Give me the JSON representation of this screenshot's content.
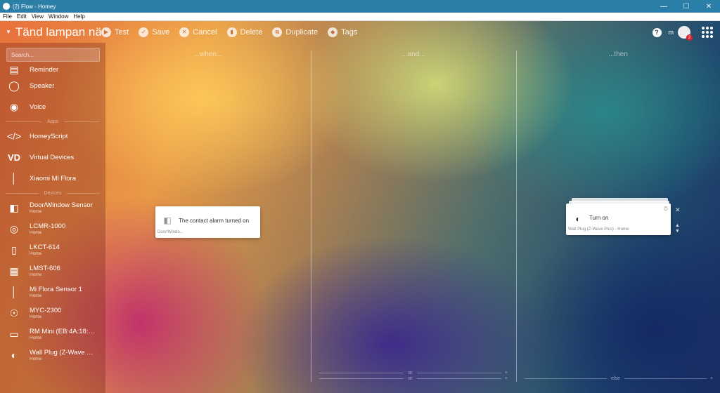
{
  "window": {
    "title": "(2) Flow - Homey"
  },
  "menu": [
    "File",
    "Edit",
    "View",
    "Window",
    "Help"
  ],
  "toolbar": {
    "flow_name": "Tänd lampan nä",
    "test": "Test",
    "save": "Save",
    "cancel": "Cancel",
    "delete": "Delete",
    "duplicate": "Duplicate",
    "tags": "Tags",
    "user_initial": "m",
    "notification_count": "2"
  },
  "sidebar": {
    "search_placeholder": "Search...",
    "partial_label": "Reminder",
    "items_top": [
      {
        "name": "Speaker",
        "icon": "speaker-icon"
      },
      {
        "name": "Voice",
        "icon": "voice-icon"
      }
    ],
    "apps_heading": "Apps",
    "apps": [
      {
        "name": "HomeyScript",
        "icon": "code-icon"
      },
      {
        "name": "Virtual Devices",
        "icon": "vd-icon"
      },
      {
        "name": "Xiaomi Mi Flora",
        "icon": "sensor-icon"
      }
    ],
    "devices_heading": "Devices",
    "devices": [
      {
        "name": "Door/Window Sensor",
        "zone": "Home"
      },
      {
        "name": "LCMR-1000",
        "zone": "Home"
      },
      {
        "name": "LKCT-614",
        "zone": "Home"
      },
      {
        "name": "LMST-606",
        "zone": "Home"
      },
      {
        "name": "Mi Flora Sensor 1",
        "zone": "Home"
      },
      {
        "name": "MYC-2300",
        "zone": "Home"
      },
      {
        "name": "RM Mini (EB:4A:18:7...",
        "zone": "Home"
      },
      {
        "name": "Wall Plug (Z-Wave Pl...",
        "zone": "Home"
      }
    ]
  },
  "columns": {
    "when": "...when...",
    "and": "...and...",
    "then": "...then"
  },
  "when_card": {
    "title": "The contact alarm turned on",
    "device": "Door/Windo..."
  },
  "then_card": {
    "title": "Turn on",
    "device": "Wall Plug (Z-Wave Plus) - Home"
  },
  "bottom": {
    "or": "or",
    "else": "else",
    "plus": "+"
  }
}
